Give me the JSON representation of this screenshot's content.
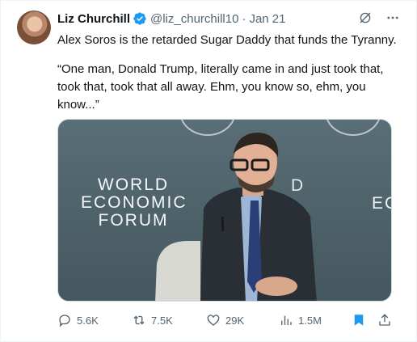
{
  "tweet": {
    "display_name": "Liz Churchill",
    "handle": "@liz_churchill10",
    "separator": "·",
    "date": "Jan 21",
    "text_line1": "Alex Soros is the retarded Sugar Daddy that funds the Tyranny.",
    "text_line2": "“One man, Donald Trump, literally came in and just took that, took that, took that all away. Ehm, you know so, ehm, you know...”",
    "media": {
      "logo_line1": "WORLD",
      "logo_line2": "ECONOMIC",
      "logo_line3": "FORUM",
      "logo_right": "EC",
      "logo_right_top": "D"
    }
  },
  "actions": {
    "replies": "5.6K",
    "reposts": "7.5K",
    "likes": "29K",
    "views": "1.5M"
  },
  "icons": {
    "verified": "verified-badge-icon",
    "grok": "grok-icon",
    "more": "more-icon",
    "reply": "reply-icon",
    "repost": "repost-icon",
    "like": "like-icon",
    "views": "views-icon",
    "bookmark": "bookmark-icon",
    "share": "share-icon"
  },
  "colors": {
    "verified": "#1d9bf0",
    "text": "#0f1419",
    "secondary": "#536471",
    "bookmark": "#1d9bf0"
  }
}
